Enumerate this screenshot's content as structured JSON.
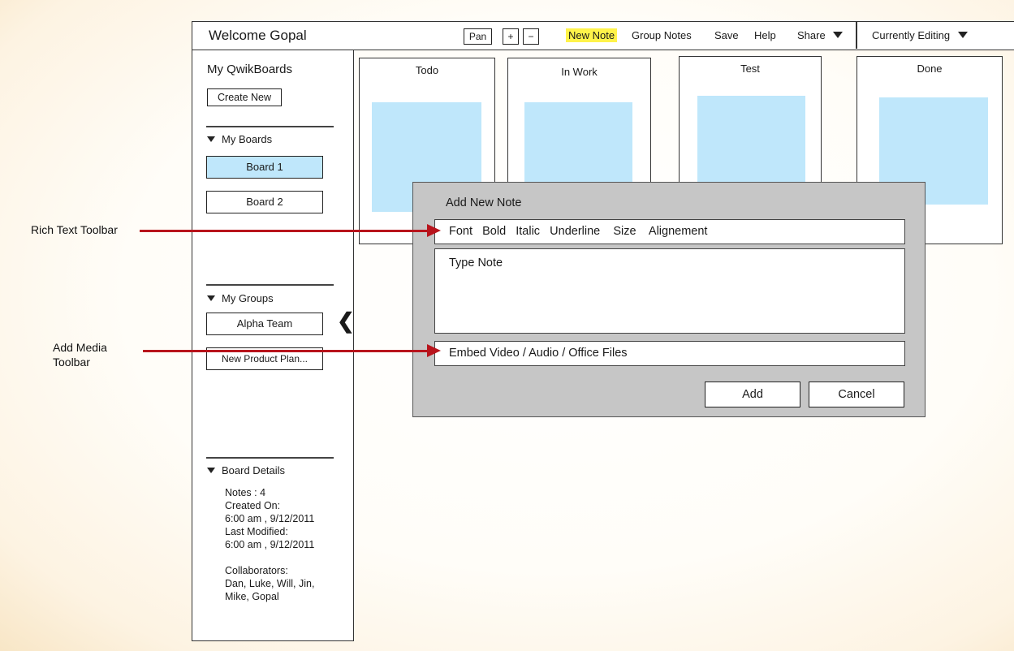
{
  "topbar": {
    "welcome": "Welcome Gopal",
    "pan": "Pan",
    "zoom_in": "+",
    "zoom_out": "−",
    "new_note": "New Note",
    "group_notes": "Group Notes",
    "save": "Save",
    "help": "Help",
    "share": "Share",
    "currently_editing": "Currently Editing"
  },
  "sidebar": {
    "title": "My QwikBoards",
    "create_new": "Create New",
    "my_boards": "My Boards",
    "boards": [
      "Board 1",
      "Board 2"
    ],
    "my_groups": "My Groups",
    "groups": [
      "Alpha Team",
      "New Product Plan..."
    ],
    "board_details": "Board Details",
    "details": {
      "notes": "Notes : 4",
      "created_label": "Created On:",
      "created_value": "6:00 am , 9/12/2011",
      "modified_label": "Last Modified:",
      "modified_value": "6:00 am , 9/12/2011",
      "collab_label": "Collaborators:",
      "collab_line1": "Dan, Luke, Will, Jin,",
      "collab_line2": "Mike, Gopal"
    },
    "collapse_glyph": "❮"
  },
  "columns": [
    "Todo",
    "In Work",
    "Test",
    "Done"
  ],
  "dialog": {
    "title": "Add New Note",
    "toolbar": [
      "Font",
      "Bold",
      "Italic",
      "Underline",
      "Size",
      "Alignement"
    ],
    "note_placeholder": "Type Note",
    "media": "Embed Video / Audio / Office Files",
    "add": "Add",
    "cancel": "Cancel"
  },
  "annotations": {
    "rich_text": "Rich Text Toolbar",
    "media_line1": "Add Media",
    "media_line2": "Toolbar"
  },
  "colors": {
    "note_fill": "#bfe7fb",
    "selected_board": "#bfe7fb",
    "highlight": "#fff34a",
    "arrow": "#b8141c",
    "dialog_bg": "#c6c6c6"
  }
}
